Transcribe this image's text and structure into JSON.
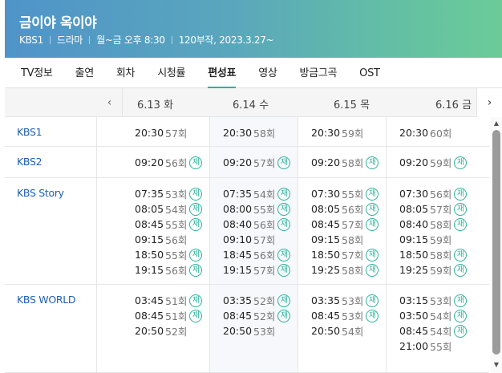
{
  "program": {
    "title": "금이야 옥이야",
    "meta": [
      "KBS1",
      "드라마",
      "월~금 오후 8:30",
      "120부작, 2023.3.27~"
    ]
  },
  "tabs": [
    "TV정보",
    "출연",
    "회차",
    "시청률",
    "편성표",
    "영상",
    "방금그곡",
    "OST"
  ],
  "active_tab": "편성표",
  "dates": [
    "6.13 화",
    "6.14 수",
    "6.15 목",
    "6.16 금"
  ],
  "nav": {
    "prev": "‹",
    "next": "›"
  },
  "rerun_mark": "재",
  "scroll": {
    "up": "▲",
    "down": "▼"
  },
  "channels": [
    {
      "name": "KBS1",
      "days": [
        [
          {
            "t": "20:30",
            "ep": "57회",
            "re": false
          }
        ],
        [
          {
            "t": "20:30",
            "ep": "58회",
            "re": false
          }
        ],
        [
          {
            "t": "20:30",
            "ep": "59회",
            "re": false
          }
        ],
        [
          {
            "t": "20:30",
            "ep": "60회",
            "re": false
          }
        ]
      ]
    },
    {
      "name": "KBS2",
      "days": [
        [
          {
            "t": "09:20",
            "ep": "56회",
            "re": true
          }
        ],
        [
          {
            "t": "09:20",
            "ep": "57회",
            "re": true
          }
        ],
        [
          {
            "t": "09:20",
            "ep": "58회",
            "re": true
          }
        ],
        [
          {
            "t": "09:20",
            "ep": "59회",
            "re": true
          }
        ]
      ]
    },
    {
      "name": "KBS Story",
      "days": [
        [
          {
            "t": "07:35",
            "ep": "53회",
            "re": true
          },
          {
            "t": "08:05",
            "ep": "54회",
            "re": true
          },
          {
            "t": "08:45",
            "ep": "55회",
            "re": true
          },
          {
            "t": "09:15",
            "ep": "56회",
            "re": false
          },
          {
            "t": "18:50",
            "ep": "55회",
            "re": true
          },
          {
            "t": "19:15",
            "ep": "56회",
            "re": true
          }
        ],
        [
          {
            "t": "07:35",
            "ep": "54회",
            "re": true
          },
          {
            "t": "08:00",
            "ep": "55회",
            "re": true
          },
          {
            "t": "08:40",
            "ep": "56회",
            "re": true
          },
          {
            "t": "09:10",
            "ep": "57회",
            "re": false
          },
          {
            "t": "18:45",
            "ep": "56회",
            "re": true
          },
          {
            "t": "19:15",
            "ep": "57회",
            "re": true
          }
        ],
        [
          {
            "t": "07:30",
            "ep": "55회",
            "re": true
          },
          {
            "t": "08:05",
            "ep": "56회",
            "re": true
          },
          {
            "t": "08:45",
            "ep": "57회",
            "re": true
          },
          {
            "t": "09:15",
            "ep": "58회",
            "re": false
          },
          {
            "t": "18:50",
            "ep": "57회",
            "re": true
          },
          {
            "t": "19:25",
            "ep": "58회",
            "re": true
          }
        ],
        [
          {
            "t": "07:30",
            "ep": "56회",
            "re": true
          },
          {
            "t": "08:05",
            "ep": "57회",
            "re": true
          },
          {
            "t": "08:40",
            "ep": "58회",
            "re": true
          },
          {
            "t": "09:15",
            "ep": "59회",
            "re": false
          },
          {
            "t": "18:50",
            "ep": "58회",
            "re": true
          },
          {
            "t": "19:25",
            "ep": "59회",
            "re": true
          }
        ]
      ]
    },
    {
      "name": "KBS WORLD",
      "days": [
        [
          {
            "t": "03:45",
            "ep": "51회",
            "re": true
          },
          {
            "t": "08:45",
            "ep": "51회",
            "re": true
          },
          {
            "t": "20:50",
            "ep": "52회",
            "re": false
          }
        ],
        [
          {
            "t": "03:35",
            "ep": "52회",
            "re": true
          },
          {
            "t": "08:45",
            "ep": "52회",
            "re": true
          },
          {
            "t": "20:50",
            "ep": "53회",
            "re": false
          }
        ],
        [
          {
            "t": "03:35",
            "ep": "53회",
            "re": true
          },
          {
            "t": "08:45",
            "ep": "53회",
            "re": true
          },
          {
            "t": "20:50",
            "ep": "54회",
            "re": false
          }
        ],
        [
          {
            "t": "03:15",
            "ep": "53회",
            "re": true
          },
          {
            "t": "03:50",
            "ep": "54회",
            "re": true
          },
          {
            "t": "08:45",
            "ep": "54회",
            "re": true
          },
          {
            "t": "21:00",
            "ep": "55회",
            "re": false
          }
        ]
      ]
    }
  ]
}
